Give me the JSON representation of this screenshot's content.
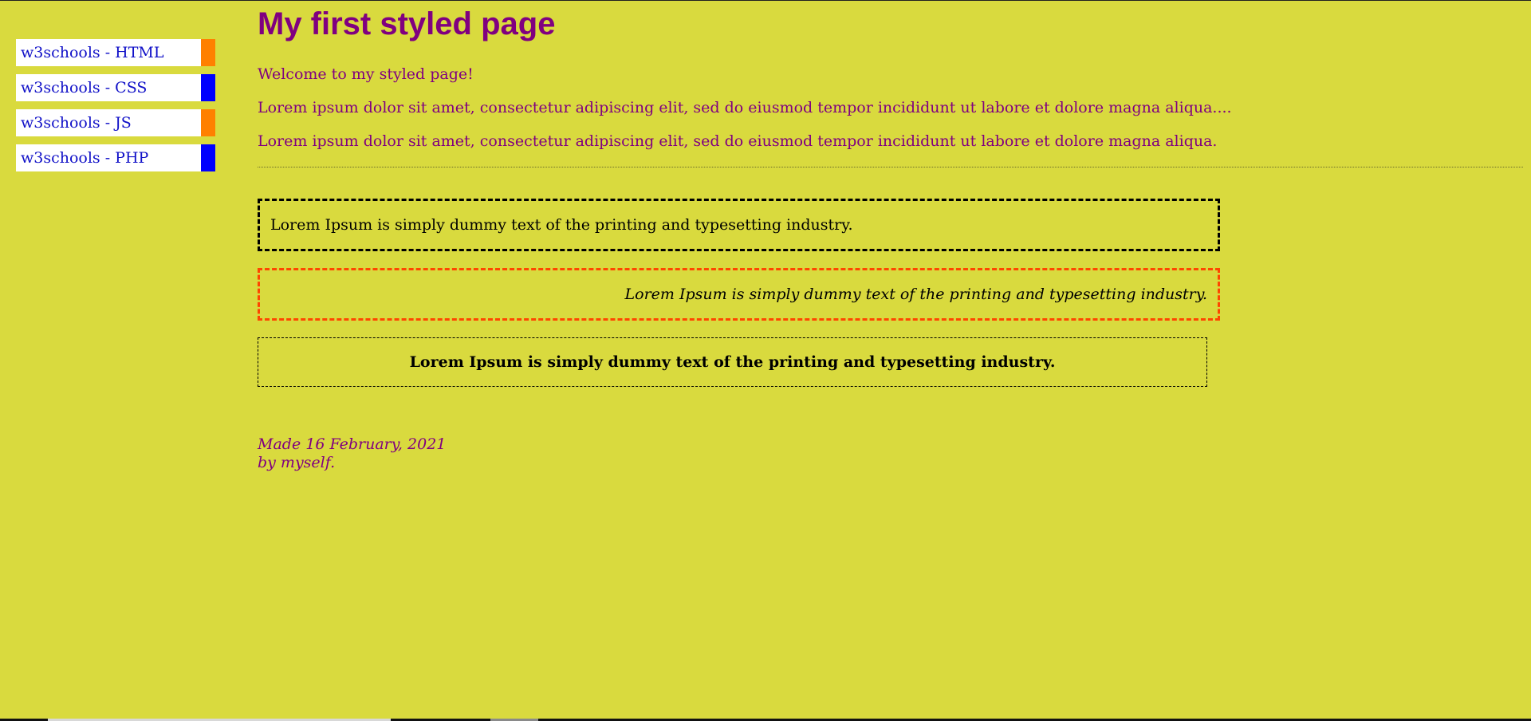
{
  "nav": {
    "items": [
      {
        "label": "w3schools - HTML",
        "marker": "orange"
      },
      {
        "label": "w3schools - CSS",
        "marker": "blue"
      },
      {
        "label": "w3schools - JS",
        "marker": "orange"
      },
      {
        "label": "w3schools - PHP",
        "marker": "blue"
      }
    ]
  },
  "main": {
    "title": "My first styled page",
    "welcome": "Welcome to my styled page!",
    "lorem1": "Lorem ipsum dolor sit amet, consectetur adipiscing elit, sed do eiusmod tempor incididunt ut labore et dolore magna aliqua....",
    "lorem2": "Lorem ipsum dolor sit amet, consectetur adipiscing elit, sed do eiusmod tempor incididunt ut labore et dolore magna aliqua.",
    "box1_text": "Lorem Ipsum is simply dummy text of the printing and typesetting industry.",
    "box2_text": "Lorem Ipsum is simply dummy text of the printing and typesetting industry.",
    "box3_text": "Lorem Ipsum is simply dummy text of the printing and typesetting industry."
  },
  "footer": {
    "line1": "Made 16 February, 2021",
    "line2": "by myself."
  },
  "colors": {
    "background": "#d9da3e",
    "heading": "#800080",
    "link": "#1010c8",
    "marker_orange": "#ff8000",
    "marker_blue": "#0000ff",
    "box2_border": "#ff4500"
  }
}
